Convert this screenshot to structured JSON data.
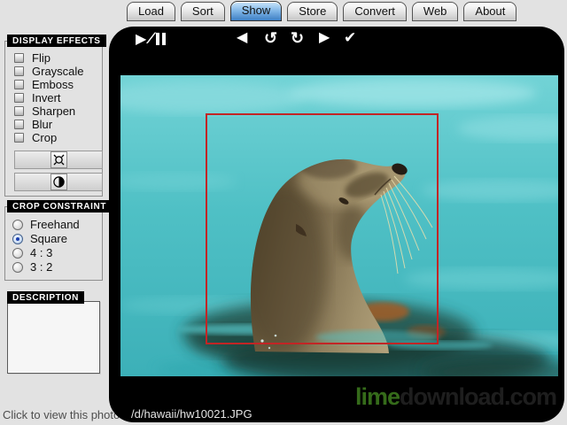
{
  "tabs": {
    "items": [
      {
        "label": "Load",
        "active": false
      },
      {
        "label": "Sort",
        "active": false
      },
      {
        "label": "Show",
        "active": true
      },
      {
        "label": "Store",
        "active": false
      },
      {
        "label": "Convert",
        "active": false
      },
      {
        "label": "Web",
        "active": false
      },
      {
        "label": "About",
        "active": false
      }
    ]
  },
  "display_effects": {
    "title": "DISPLAY EFFECTS",
    "options": [
      {
        "label": "Flip",
        "checked": false
      },
      {
        "label": "Grayscale",
        "checked": false
      },
      {
        "label": "Emboss",
        "checked": false
      },
      {
        "label": "Invert",
        "checked": false
      },
      {
        "label": "Sharpen",
        "checked": false
      },
      {
        "label": "Blur",
        "checked": false
      },
      {
        "label": "Crop",
        "checked": false
      }
    ],
    "brightness_icon": "brightness-sun",
    "contrast_icon": "contrast-half-circle"
  },
  "crop_constraint": {
    "title": "CROP CONSTRAINT",
    "options": [
      {
        "label": "Freehand",
        "selected": false
      },
      {
        "label": "Square",
        "selected": true
      },
      {
        "label": "4 : 3",
        "selected": false
      },
      {
        "label": "3 : 2",
        "selected": false
      }
    ]
  },
  "description": {
    "title": "DESCRIPTION",
    "value": ""
  },
  "footer": {
    "hint": "Click to view this photo"
  },
  "viewer": {
    "toolbar": {
      "play_icon": "▶",
      "slash": "∕",
      "prev_icon": "◀",
      "rotate_ccw_icon": "↺",
      "rotate_cw_icon": "↻",
      "next_icon": "▶",
      "accept_icon": "✔"
    },
    "filename": "/d/hawaii/hw10021.JPG",
    "watermark": {
      "prefix": "lime",
      "suffix": "download.com"
    }
  },
  "colors": {
    "active_tab_blue": "#3d7fc4",
    "crop_red": "#c22525",
    "watermark_green": "#356b1a",
    "water_turquoise": "#4fc0c5",
    "panel_label_bg": "#000000"
  }
}
